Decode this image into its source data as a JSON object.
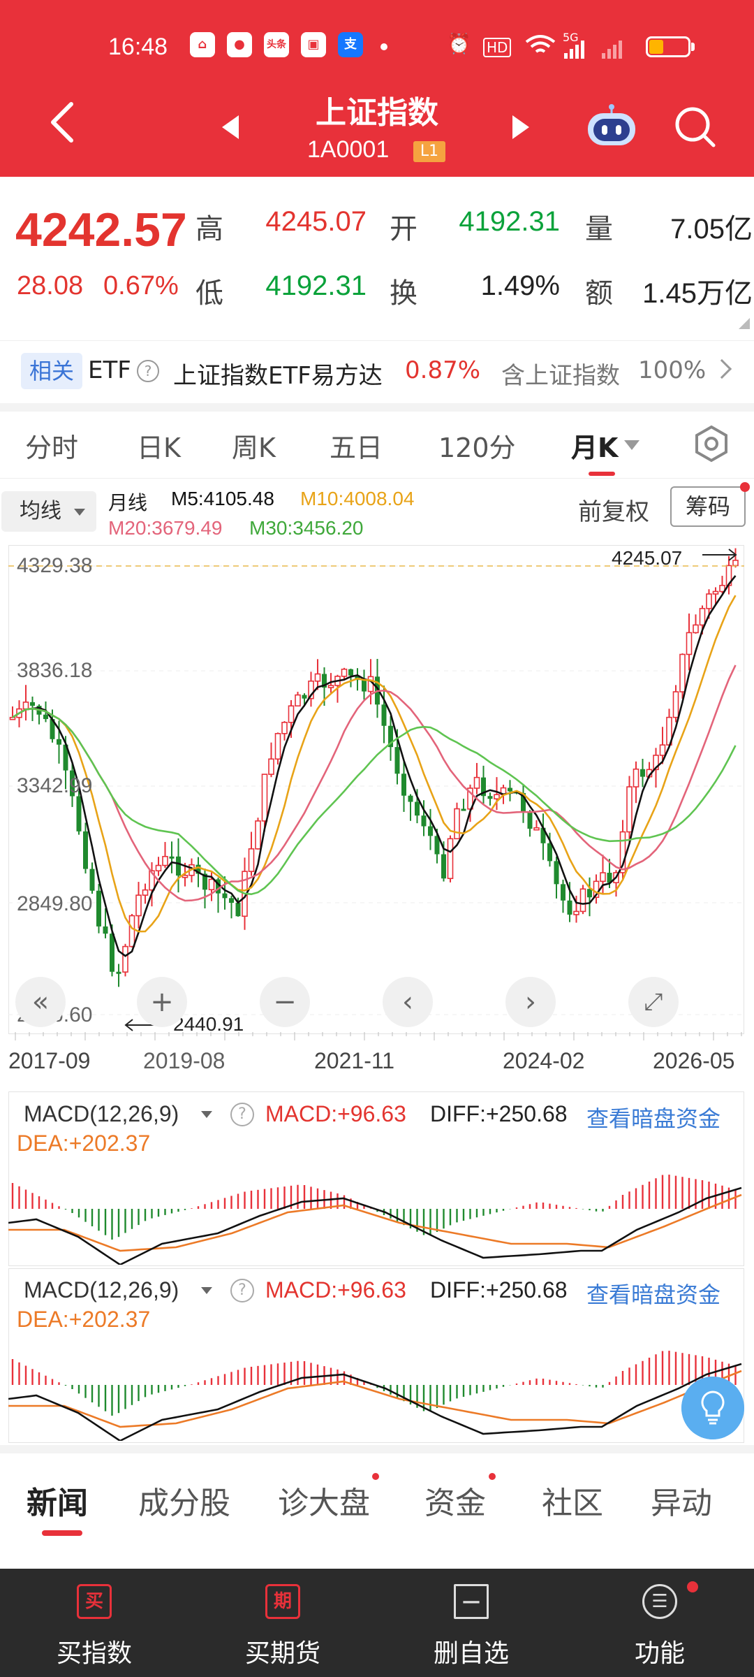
{
  "status_bar": {
    "time": "16:48",
    "app_icons": [
      "⌂",
      "●",
      "头条",
      "▣",
      "支"
    ],
    "signal": "5G",
    "icons": [
      "alarm-icon",
      "hd-icon",
      "wifi-icon",
      "signal-icon",
      "battery-icon"
    ]
  },
  "header": {
    "title": "上证指数",
    "code": "1A0001",
    "level_badge": "L1",
    "colors": {
      "brand": "#e8313a"
    }
  },
  "quote": {
    "price": "4242.57",
    "change": "28.08",
    "change_pct": "0.67%",
    "high_label": "高",
    "high": "4245.07",
    "open_label": "开",
    "open": "4192.31",
    "volume_label": "量",
    "volume": "7.05亿",
    "low_label": "低",
    "low": "4192.31",
    "turnover_label": "换",
    "turnover": "1.49%",
    "amount_label": "额",
    "amount": "1.45万亿"
  },
  "etf": {
    "tag": "相关",
    "type": "ETF",
    "help": "?",
    "name": "上证指数ETF易方达",
    "change_pct": "0.87%",
    "holding_label": "含上证指数",
    "holding_pct": "100%"
  },
  "period_tabs": [
    {
      "label": "分时"
    },
    {
      "label": "日K"
    },
    {
      "label": "周K"
    },
    {
      "label": "五日"
    },
    {
      "label": "120分"
    },
    {
      "label": "月K",
      "active": true
    }
  ],
  "indicators": {
    "ma_button": "均线",
    "line_type": "月线",
    "m5": "M5:4105.48",
    "m10": "M10:4008.04",
    "m20": "M20:3679.49",
    "m30": "M30:3456.20",
    "adjust": "前复权",
    "chips": "筹码"
  },
  "chart_data": {
    "type": "candlestick",
    "y_ticks": [
      "4329.38",
      "3836.18",
      "3342.99",
      "2849.80",
      "2356.60"
    ],
    "ylim": [
      2356.6,
      4329.38
    ],
    "x_ticks": [
      "2017-09",
      "2019-08",
      "2021-11",
      "2024-02",
      "2026-05"
    ],
    "max_label": "4245.07",
    "min_label": "2440.91",
    "series": [
      {
        "name": "M5",
        "color": "#111111"
      },
      {
        "name": "M10",
        "color": "#e8a317"
      },
      {
        "name": "M20",
        "color": "#e3647a"
      },
      {
        "name": "M30",
        "color": "#5fc451"
      }
    ],
    "controls": [
      "«",
      "+",
      "−",
      "‹",
      "›",
      "⤢"
    ]
  },
  "macd": [
    {
      "selector": "MACD(12,26,9)",
      "help": "?",
      "macd": "MACD:+96.63",
      "diff": "DIFF:+250.68",
      "link": "查看暗盘资金",
      "dea": "DEA:+202.37"
    },
    {
      "selector": "MACD(12,26,9)",
      "help": "?",
      "macd": "MACD:+96.63",
      "diff": "DIFF:+250.68",
      "link": "查看暗盘资金",
      "dea": "DEA:+202.37"
    }
  ],
  "news_tabs": [
    {
      "label": "新闻",
      "active": true
    },
    {
      "label": "成分股"
    },
    {
      "label": "诊大盘",
      "dot": true
    },
    {
      "label": "资金",
      "dot": true
    },
    {
      "label": "社区"
    },
    {
      "label": "异动"
    }
  ],
  "bottom_bar": [
    {
      "icon": "买",
      "label": "买指数"
    },
    {
      "icon": "期",
      "label": "买期货"
    },
    {
      "icon": "—",
      "label": "删自选"
    },
    {
      "icon": "☰",
      "label": "功能"
    }
  ]
}
